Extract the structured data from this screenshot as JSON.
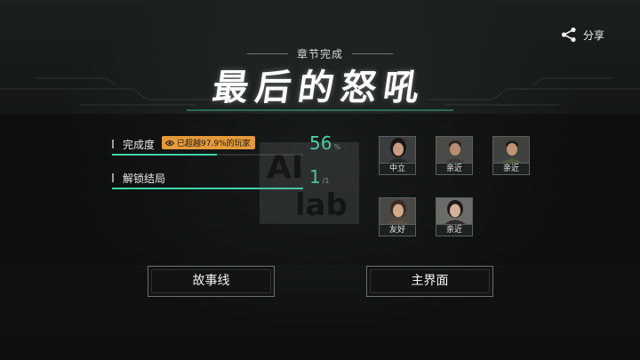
{
  "share": {
    "label": "分享",
    "icon": "share-icon"
  },
  "header": {
    "subtitle": "章节完成",
    "title": "最后的怒吼"
  },
  "stats": {
    "completion": {
      "label": "完成度",
      "badge": "已超越97.9%的玩家",
      "value": "56",
      "unit": "%",
      "progress": 0.56
    },
    "endings": {
      "label": "解锁结局",
      "value": "1",
      "unit": "/1",
      "progress": 1.0
    }
  },
  "watermark": {
    "text": "AI Lab"
  },
  "characters": [
    {
      "relation": "中立"
    },
    {
      "relation": "亲近"
    },
    {
      "relation": "亲近"
    },
    {
      "relation": "友好"
    },
    {
      "relation": "亲近"
    }
  ],
  "buttons": {
    "storyline": "故事线",
    "main_menu": "主界面"
  },
  "colors": {
    "accent": "#45d6ad",
    "badge": "#e59a3a",
    "background": "#121414"
  }
}
